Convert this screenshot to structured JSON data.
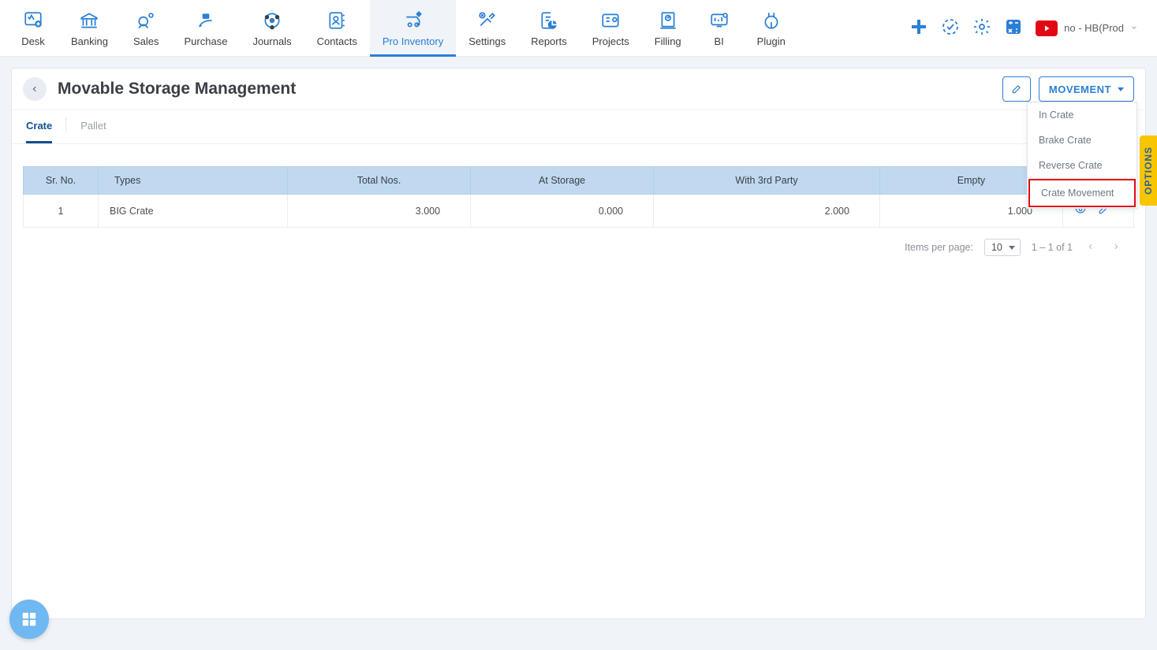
{
  "nav": [
    {
      "id": "desk",
      "label": "Desk"
    },
    {
      "id": "banking",
      "label": "Banking"
    },
    {
      "id": "sales",
      "label": "Sales"
    },
    {
      "id": "purchase",
      "label": "Purchase"
    },
    {
      "id": "journals",
      "label": "Journals"
    },
    {
      "id": "contacts",
      "label": "Contacts"
    },
    {
      "id": "pro-inventory",
      "label": "Pro Inventory",
      "active": true
    },
    {
      "id": "settings",
      "label": "Settings"
    },
    {
      "id": "reports",
      "label": "Reports"
    },
    {
      "id": "projects",
      "label": "Projects"
    },
    {
      "id": "filling",
      "label": "Filling"
    },
    {
      "id": "bi",
      "label": "BI"
    },
    {
      "id": "plugin",
      "label": "Plugin"
    }
  ],
  "org_label": "no - HB(Prod",
  "page": {
    "title": "Movable Storage Management",
    "movement_button": "MOVEMENT"
  },
  "movement_menu": [
    {
      "label": "In Crate"
    },
    {
      "label": "Brake Crate"
    },
    {
      "label": "Reverse Crate"
    },
    {
      "label": "Crate Movement",
      "highlight": true
    }
  ],
  "tabs": [
    {
      "label": "Crate",
      "active": true
    },
    {
      "label": "Pallet"
    }
  ],
  "table": {
    "columns": [
      "Sr. No.",
      "Types",
      "Total Nos.",
      "At Storage",
      "With 3rd Party",
      "Empty"
    ],
    "rows": [
      {
        "sr": "1",
        "types": "BIG Crate",
        "total": "3.000",
        "storage": "0.000",
        "third": "2.000",
        "empty": "1.000"
      }
    ]
  },
  "paginator": {
    "items_label": "Items per page:",
    "per_page": "10",
    "range": "1 – 1 of 1"
  },
  "options_label": "OPTIONS"
}
